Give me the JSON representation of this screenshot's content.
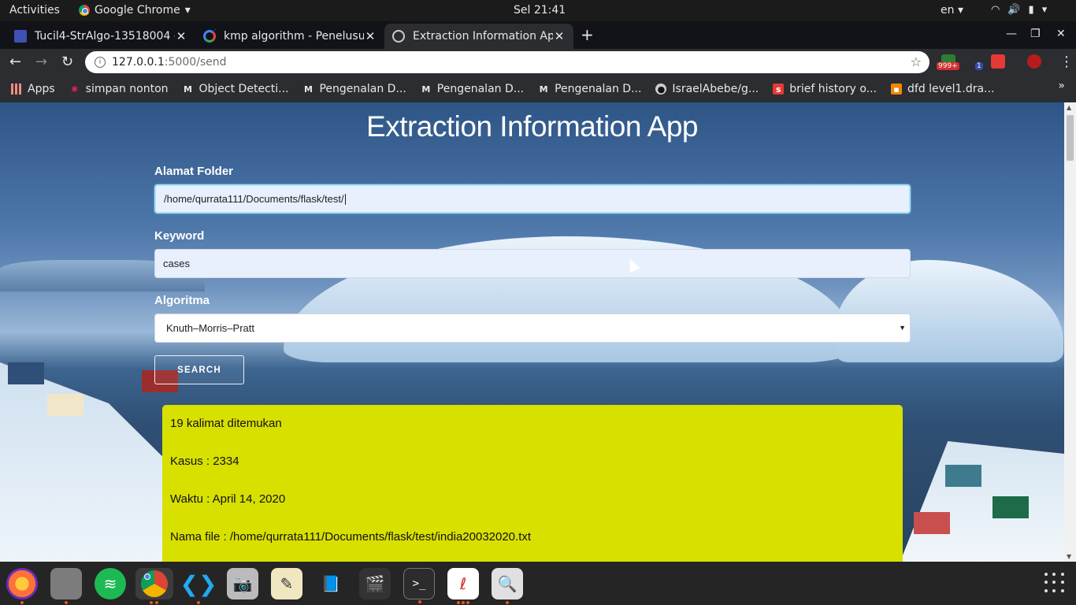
{
  "system": {
    "activities": "Activities",
    "app_name": "Google Chrome",
    "clock": "Sel 21:41",
    "lang": "en"
  },
  "tabs": [
    {
      "title": "Tucil4-StrAlgo-13518004 -",
      "icon": "docs-icon"
    },
    {
      "title": "kmp algorithm - Penelusu",
      "icon": "google-icon"
    },
    {
      "title": "Extraction Information Ap",
      "icon": "globe-icon",
      "active": true
    }
  ],
  "address": {
    "host": "127.0.0.1",
    "path": ":5000/send"
  },
  "extensions": {
    "badge1": "999+",
    "badge2": "1"
  },
  "bookmarks": [
    {
      "label": "Apps",
      "icon": "apps-grid-icon"
    },
    {
      "label": "simpan nonton",
      "icon": "slack-icon"
    },
    {
      "label": "Object Detecti...",
      "icon": "medium-icon"
    },
    {
      "label": "Pengenalan D...",
      "icon": "medium-icon"
    },
    {
      "label": "Pengenalan D...",
      "icon": "medium-icon"
    },
    {
      "label": "Pengenalan D...",
      "icon": "medium-icon"
    },
    {
      "label": "IsraelAbebe/g...",
      "icon": "github-icon"
    },
    {
      "label": "brief history o...",
      "icon": "speakerdeck-icon"
    },
    {
      "label": "dfd level1.dra...",
      "icon": "drawio-icon"
    }
  ],
  "page": {
    "title": "Extraction Information App",
    "folder_label": "Alamat Folder",
    "folder_value": "/home/qurrata111/Documents/flask/test/",
    "keyword_label": "Keyword",
    "keyword_value": "cases",
    "algo_label": "Algoritma",
    "algo_value": "Knuth–Morris–Pratt",
    "search_label": "SEARCH",
    "results": [
      "19 kalimat ditemukan",
      "Kasus : 2334",
      "Waktu : April 14, 2020",
      "Nama file : /home/qurrata111/Documents/flask/test/india20032020.txt"
    ]
  },
  "dock": [
    {
      "name": "firefox-icon",
      "active": false
    },
    {
      "name": "files-icon",
      "active": false
    },
    {
      "name": "spotify-icon",
      "active": false
    },
    {
      "name": "chrome-icon",
      "active": true
    },
    {
      "name": "vscode-icon",
      "active": false
    },
    {
      "name": "camera-icon",
      "active": false
    },
    {
      "name": "text-editor-icon",
      "active": false
    },
    {
      "name": "book-icon",
      "active": false
    },
    {
      "name": "video-editor-icon",
      "active": false
    },
    {
      "name": "terminal-icon",
      "active": false
    },
    {
      "name": "pdf-viewer-icon",
      "active": false
    },
    {
      "name": "image-viewer-icon",
      "active": false
    }
  ]
}
